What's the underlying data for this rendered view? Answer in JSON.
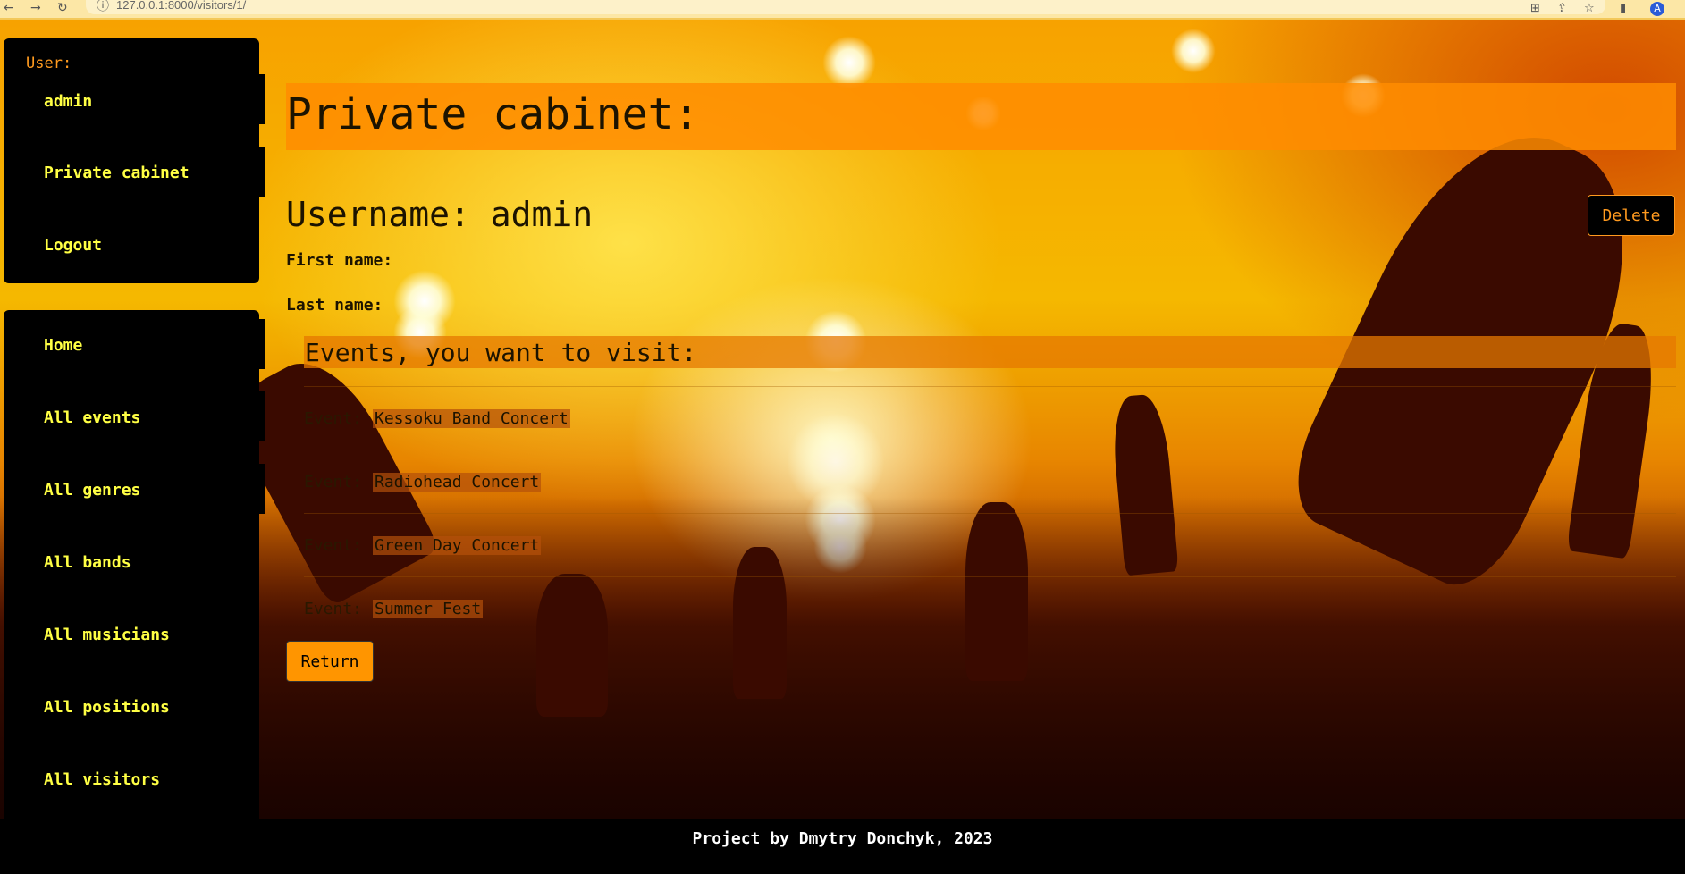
{
  "browser": {
    "url": "127.0.0.1:8000/visitors/1/"
  },
  "sidebar": {
    "user_label": "User:",
    "user_items": [
      {
        "label": "admin"
      },
      {
        "label": "Private cabinet"
      },
      {
        "label": "Logout"
      }
    ],
    "nav_items": [
      {
        "label": "Home"
      },
      {
        "label": "All events"
      },
      {
        "label": "All genres"
      },
      {
        "label": "All bands"
      },
      {
        "label": "All musicians"
      },
      {
        "label": "All positions"
      },
      {
        "label": "All visitors"
      }
    ]
  },
  "main": {
    "title": "Private cabinet:",
    "username_line": "Username: admin",
    "delete_label": "Delete",
    "first_name_label": "First name:",
    "last_name_label": "Last name:",
    "events_heading": "Events, you want to visit:",
    "event_prefix": "Event:",
    "events": [
      {
        "name": "Kessoku Band Concert"
      },
      {
        "name": "Radiohead Concert"
      },
      {
        "name": "Green Day Concert"
      },
      {
        "name": "Summer Fest"
      }
    ],
    "return_label": "Return"
  },
  "footer": {
    "text": "Project by Dmytry Donchyk, 2023"
  },
  "colors": {
    "accent": "#ff9500",
    "link": "#ffff44",
    "user_label": "#ff9a1f"
  }
}
